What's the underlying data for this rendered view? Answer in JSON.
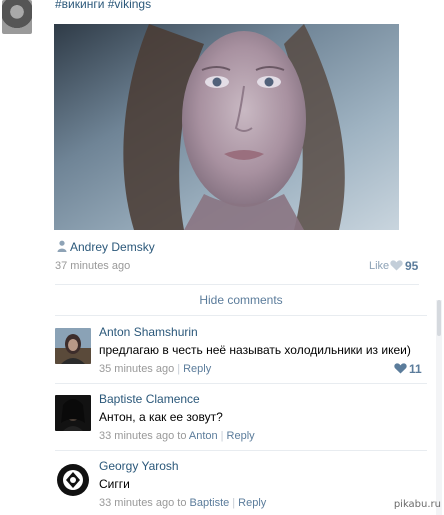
{
  "post": {
    "hashtags": "#викинги #vikings",
    "author": "Andrey Demsky",
    "time": "37 minutes ago",
    "like_label": "Like",
    "like_count": "95",
    "hide_comments_label": "Hide comments",
    "icons": {
      "author": "person-icon",
      "like": "heart-icon"
    }
  },
  "comments": [
    {
      "author": "Anton Shamshurin",
      "text": "предлагаю в честь неё называть холодильники из икеи)",
      "time": "35 minutes ago",
      "reply": "Reply",
      "likes": "11"
    },
    {
      "author": "Baptiste Clamence",
      "text": "Антон, а как ее зовут?",
      "time": "33 minutes ago",
      "to_word": "to",
      "to": "Anton",
      "reply": "Reply"
    },
    {
      "author": "Georgy Yarosh",
      "text": "Сигги",
      "time": "33 minutes ago",
      "to_word": "to",
      "to": "Baptiste",
      "reply": "Reply"
    }
  ],
  "watermark": "pikabu.ru",
  "colors": {
    "link": "#2b587a",
    "muted": "#999999",
    "accent": "#5b7c9b"
  }
}
